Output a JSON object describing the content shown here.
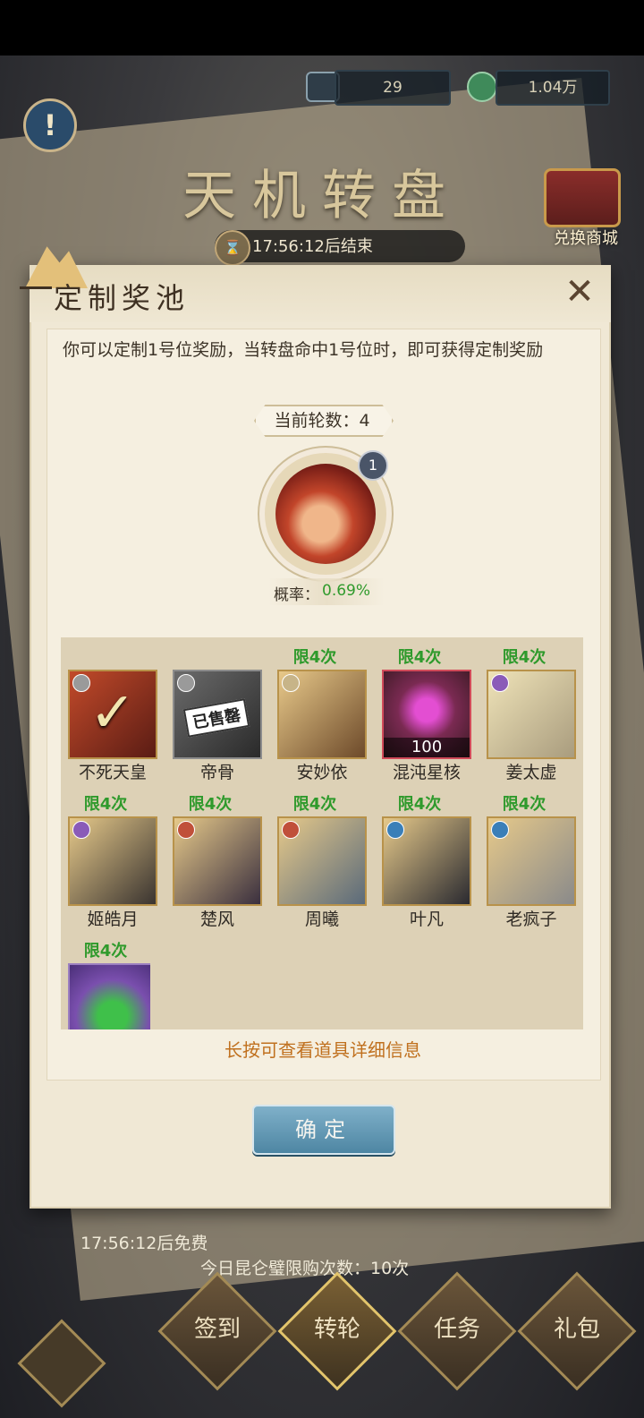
{
  "header": {
    "resource1": {
      "icon": "book-icon",
      "value": "29"
    },
    "resource2": {
      "icon": "jade-coin-icon",
      "value": "1.04万"
    }
  },
  "page": {
    "title": "天机转盘",
    "timer": "17:56:12后结束",
    "shop_label": "兑换商城"
  },
  "dialog": {
    "title": "定制奖池",
    "description": "你可以定制1号位奖励，当转盘命中1号位时，即可获得定制奖励",
    "rounds": "当前轮数：4",
    "selected_slot": "1",
    "probability_label": "概率：",
    "probability_value": "0.69%",
    "hint": "长按可查看道具详细信息",
    "confirm": "确定"
  },
  "rewards": [
    {
      "name": "不死天皇",
      "limit": "",
      "state": "selected"
    },
    {
      "name": "帝骨",
      "limit": "",
      "state": "sold",
      "sold_text": "已售罄"
    },
    {
      "name": "安妙依",
      "limit": "限4次"
    },
    {
      "name": "混沌星核",
      "limit": "限4次",
      "qty": "100"
    },
    {
      "name": "姜太虚",
      "limit": "限4次"
    },
    {
      "name": "姬皓月",
      "limit": "限4次"
    },
    {
      "name": "楚风",
      "limit": "限4次"
    },
    {
      "name": "周曦",
      "limit": "限4次"
    },
    {
      "name": "叶凡",
      "limit": "限4次"
    },
    {
      "name": "老疯子",
      "limit": "限4次"
    },
    {
      "name": "",
      "limit": "限4次"
    }
  ],
  "footer": {
    "free_timer": "17:56:12后免费",
    "purchase_limit": "今日昆仑璧限购次数：10次"
  },
  "bottom_nav": [
    {
      "label": "签到"
    },
    {
      "label": "转轮"
    },
    {
      "label": "任务"
    },
    {
      "label": "礼包"
    }
  ]
}
